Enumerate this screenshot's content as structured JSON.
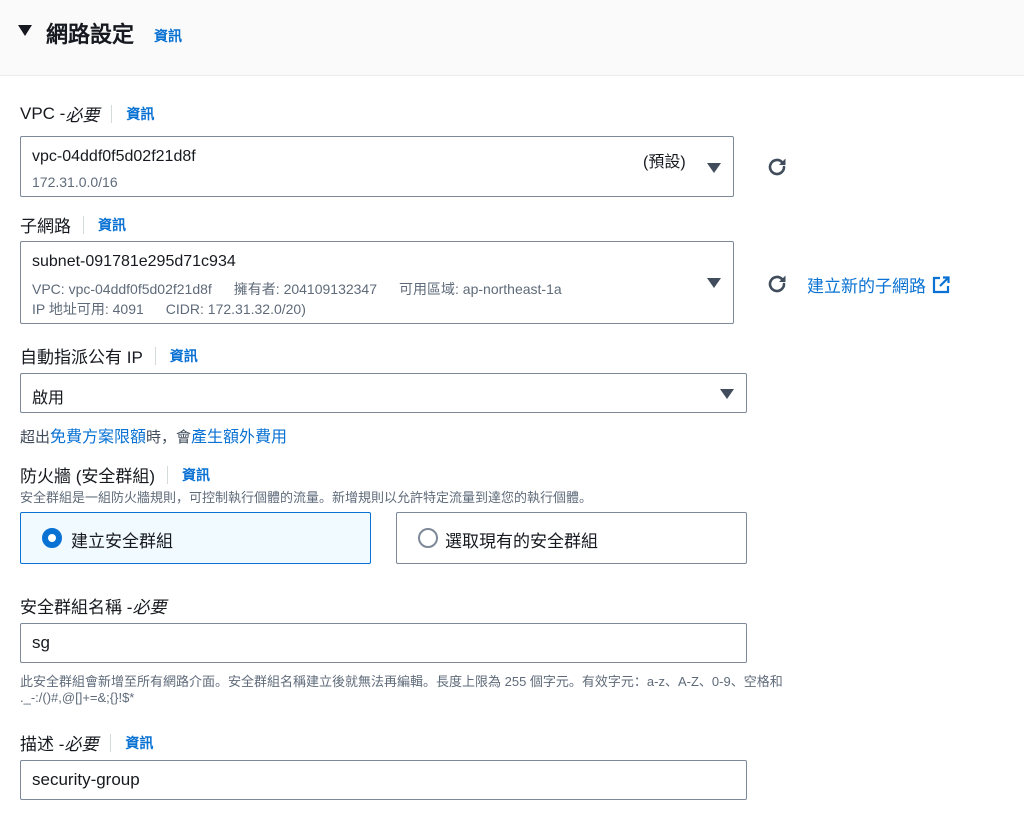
{
  "section": {
    "title": "網路設定",
    "info": "資訊"
  },
  "vpc": {
    "label": "VPC - ",
    "required": "必要",
    "info": "資訊",
    "value": "vpc-04ddf0f5d02f21d8f",
    "default_tag": "(預設)",
    "cidr": "172.31.0.0/16"
  },
  "subnet": {
    "label": "子網路",
    "info": "資訊",
    "value": "subnet-091781e295d71c934",
    "detail_vpc": "VPC: vpc-04ddf0f5d02f21d8f",
    "detail_owner": "擁有者: 204109132347",
    "detail_az": "可用區域: ap-northeast-1a",
    "detail_ips": "IP 地址可用: 4091",
    "detail_cidr": "CIDR: 172.31.32.0/20)",
    "create_link": "建立新的子網路"
  },
  "public_ip": {
    "label": "自動指派公有 IP",
    "info": "資訊",
    "value": "啟用",
    "hint_pre": "超出",
    "hint_link1": "免費方案限額",
    "hint_mid": "時，會",
    "hint_link2": "產生額外費用"
  },
  "firewall": {
    "label": "防火牆 (安全群組)",
    "info": "資訊",
    "description": "安全群組是一組防火牆規則，可控制執行個體的流量。新增規則以允許特定流量到達您的執行個體。",
    "options": [
      {
        "label": "建立安全群組",
        "selected": true
      },
      {
        "label": "選取現有的安全群組",
        "selected": false
      }
    ]
  },
  "sg_name": {
    "label": "安全群組名稱 - ",
    "required": "必要",
    "value": "sg",
    "hint_line1": "此安全群組會新增至所有網路介面。安全群組名稱建立後就無法再編輯。長度上限為 255 個字元。有效字元：a-z、A-Z、0-9、空格和",
    "hint_line2": "._-:/()#,@[]+=&;{}!$*"
  },
  "description": {
    "label": "描述 - ",
    "required": "必要",
    "info": "資訊",
    "value": "security-group"
  },
  "icons": {
    "caret": "caret-down-icon",
    "dropdown": "dropdown-triangle-icon",
    "refresh": "refresh-icon",
    "external": "external-link-icon"
  },
  "colors": {
    "link": "#0972d3",
    "border": "#7d8998",
    "selected_bg": "#f1faff"
  }
}
